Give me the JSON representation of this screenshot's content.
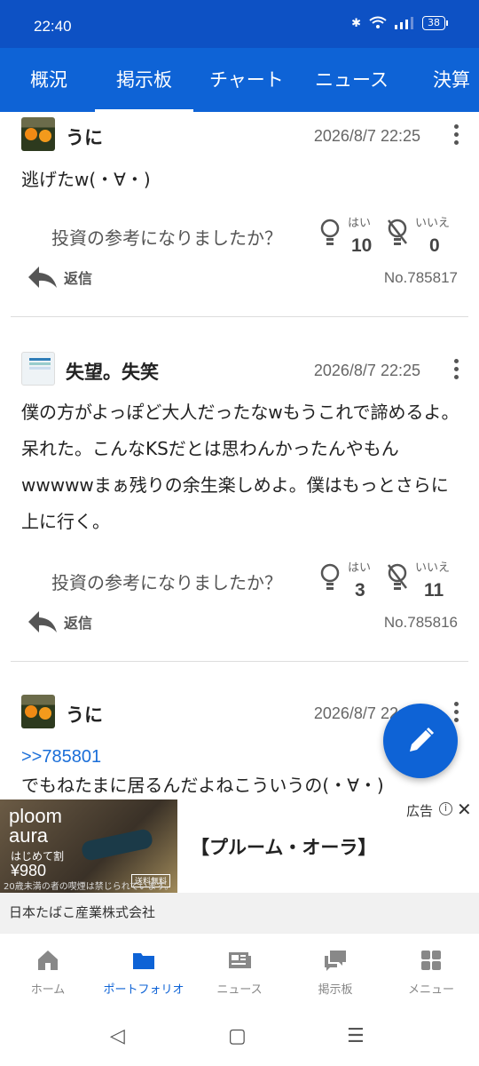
{
  "status": {
    "time": "22:40",
    "battery": "38"
  },
  "tabs": [
    {
      "label": "概況"
    },
    {
      "label": "掲示板",
      "active": true
    },
    {
      "label": "チャート"
    },
    {
      "label": "ニュース"
    },
    {
      "label": "決算"
    }
  ],
  "vote_question": "投資の参考になりましたか？",
  "yes_label": "はい",
  "no_label": "いいえ",
  "reply_label": "返信",
  "posts": [
    {
      "user": "うに",
      "date": "2026/8/7 22:25",
      "text": "逃げたw(・∀・)",
      "yes": "10",
      "no": "0",
      "number": "No.785817"
    },
    {
      "user": "失望。失笑",
      "date": "2026/8/7 22:25",
      "text": "僕の方がよっぽど大人だったなwもうこれで諦めるよ。呆れた。こんなKSだとは思わんかったんやもんwwwwwまぁ残りの余生楽しめよ。僕はもっとさらに上に行く。",
      "yes": "3",
      "no": "11",
      "number": "No.785816"
    },
    {
      "user": "うに",
      "date": "2026/8/7 22:25",
      "reference": ">>785801",
      "text": "でもねたまに居るんだよねこういうの(・∀・)"
    }
  ],
  "ad": {
    "label": "広告",
    "info": "i",
    "close": "✕",
    "brand_line1": "ploom",
    "brand_line2": "aura",
    "promo": "はじめて割",
    "price": "¥980",
    "shipping": "送料無料",
    "warning": "20歳未満の者の喫煙は禁じられています。",
    "title": "【プルーム・オーラ】",
    "advertiser": "日本たばこ産業株式会社"
  },
  "bottom_nav": [
    {
      "label": "ホーム",
      "icon": "home-icon"
    },
    {
      "label": "ポートフォリオ",
      "icon": "folder-icon",
      "active": true
    },
    {
      "label": "ニュース",
      "icon": "news-icon"
    },
    {
      "label": "掲示板",
      "icon": "chat-icon"
    },
    {
      "label": "メニュー",
      "icon": "grid-icon"
    }
  ],
  "colors": {
    "brand": "#0e63d6",
    "statusbar": "#0d51c4",
    "link": "#1a6ed8"
  }
}
